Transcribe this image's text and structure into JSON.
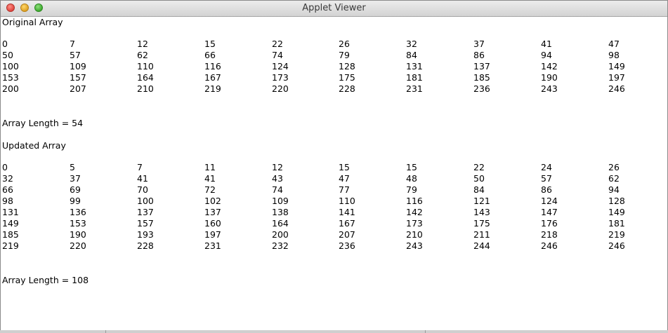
{
  "window": {
    "title": "Applet Viewer"
  },
  "original": {
    "heading": "Original Array",
    "rows": [
      [
        "0",
        "7",
        "12",
        "15",
        "22",
        "26",
        "32",
        "37",
        "41",
        "47"
      ],
      [
        "50",
        "57",
        "62",
        "66",
        "74",
        "79",
        "84",
        "86",
        "94",
        "98"
      ],
      [
        "100",
        "109",
        "110",
        "116",
        "124",
        "128",
        "131",
        "137",
        "142",
        "149"
      ],
      [
        "153",
        "157",
        "164",
        "167",
        "173",
        "175",
        "181",
        "185",
        "190",
        "197"
      ],
      [
        "200",
        "207",
        "210",
        "219",
        "220",
        "228",
        "231",
        "236",
        "243",
        "246"
      ]
    ],
    "length_text": "Array Length = 54"
  },
  "updated": {
    "heading": "Updated Array",
    "rows": [
      [
        "0",
        "5",
        "7",
        "11",
        "12",
        "15",
        "15",
        "22",
        "24",
        "26"
      ],
      [
        "32",
        "37",
        "41",
        "41",
        "43",
        "47",
        "48",
        "50",
        "57",
        "62"
      ],
      [
        "66",
        "69",
        "70",
        "72",
        "74",
        "77",
        "79",
        "84",
        "86",
        "94"
      ],
      [
        "98",
        "99",
        "100",
        "102",
        "109",
        "110",
        "116",
        "121",
        "124",
        "128"
      ],
      [
        "131",
        "136",
        "137",
        "137",
        "138",
        "141",
        "142",
        "143",
        "147",
        "149"
      ],
      [
        "149",
        "153",
        "157",
        "160",
        "164",
        "167",
        "173",
        "175",
        "176",
        "181"
      ],
      [
        "185",
        "190",
        "193",
        "197",
        "200",
        "207",
        "210",
        "211",
        "218",
        "219"
      ],
      [
        "219",
        "220",
        "228",
        "231",
        "232",
        "236",
        "243",
        "244",
        "246",
        "246"
      ]
    ],
    "length_text": "Array Length = 108"
  }
}
